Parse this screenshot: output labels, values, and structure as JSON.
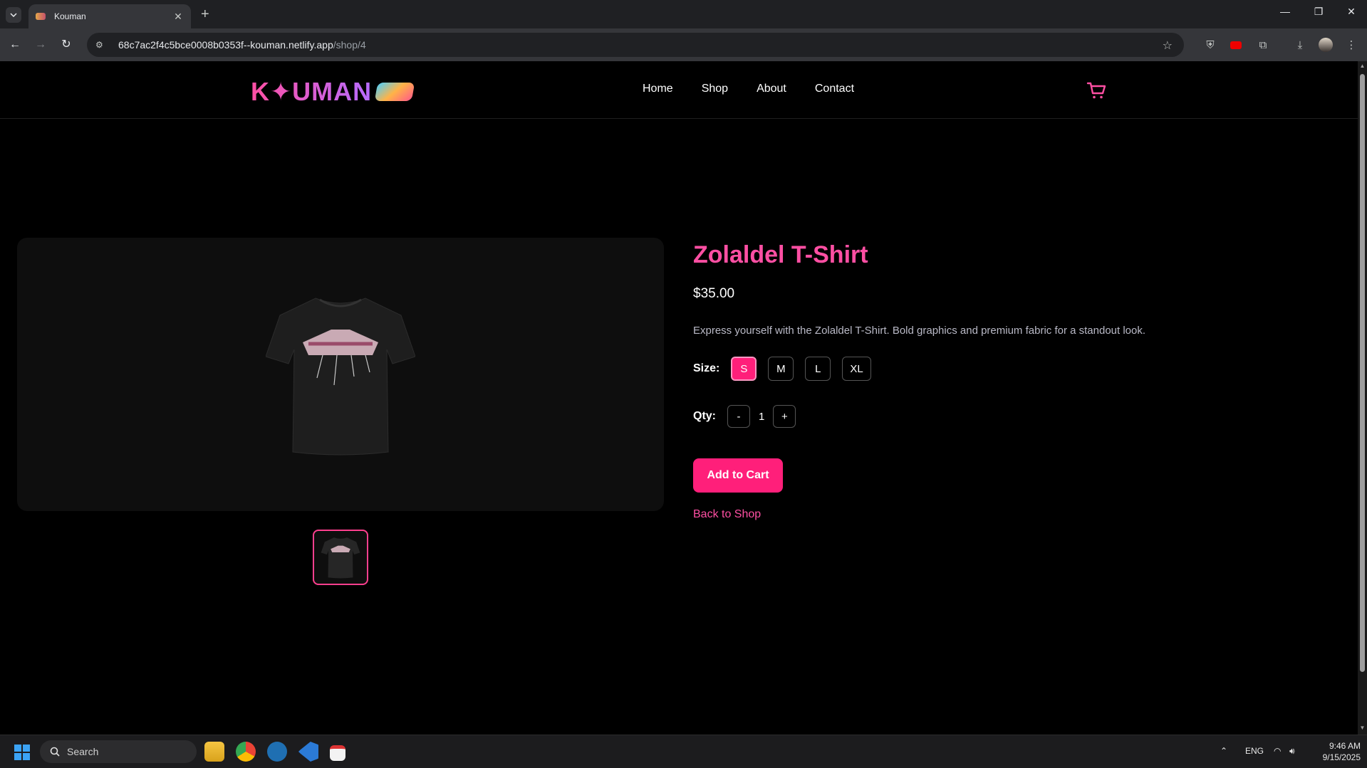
{
  "browser": {
    "tab_title": "Kouman",
    "new_tab": "+",
    "url_host": "68c7ac2f4c5bce0008b0353f--kouman.netlify.app",
    "url_path": "/shop/4"
  },
  "site": {
    "logo_text": "K✦UMAN",
    "nav": [
      "Home",
      "Shop",
      "About",
      "Contact"
    ],
    "accent_color": "#ff1f7a",
    "brand_pink": "#ff4fa3"
  },
  "product": {
    "title": "Zolaldel T-Shirt",
    "price": "$35.00",
    "description": "Express yourself with the Zolaldel T-Shirt. Bold graphics and premium fabric for a standout look.",
    "size_label": "Size:",
    "sizes": [
      "S",
      "M",
      "L",
      "XL"
    ],
    "selected_size": "S",
    "qty_label": "Qty:",
    "qty_minus": "-",
    "qty_value": "1",
    "qty_plus": "+",
    "add_to_cart": "Add to Cart",
    "back_link": "Back to Shop"
  },
  "taskbar": {
    "search_placeholder": "Search",
    "language": "ENG",
    "time": "9:46 AM",
    "date": "9/15/2025"
  }
}
